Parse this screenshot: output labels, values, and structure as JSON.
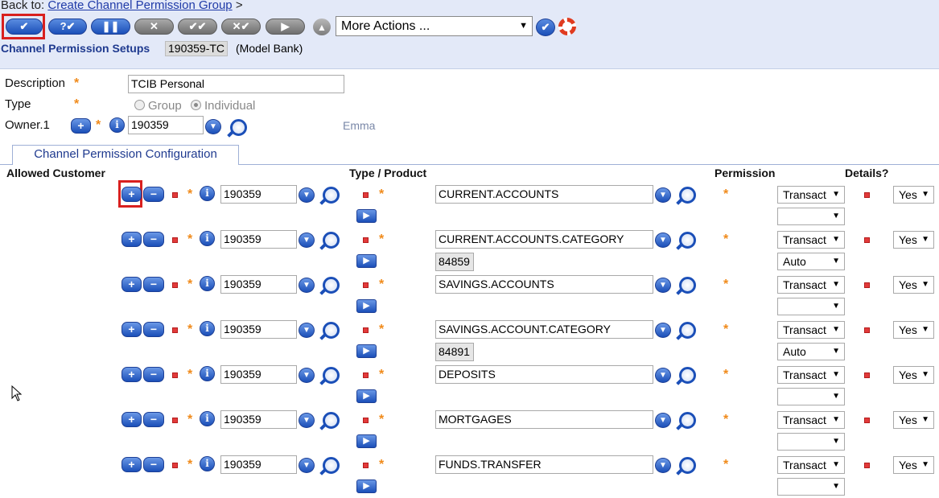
{
  "header": {
    "back_prefix": "Back to:",
    "back_link": "Create Channel Permission Group",
    "back_suffix": ">",
    "more_actions": "More Actions ...",
    "setup_title": "Channel Permission Setups",
    "record_id": "190359-TC",
    "bank": "(Model Bank)"
  },
  "toolbar": [
    "commit",
    "validate",
    "hold",
    "delete",
    "authorise",
    "reverse",
    "next"
  ],
  "form": {
    "description_label": "Description",
    "description_value": "TCIB Personal",
    "type_label": "Type",
    "type_group": "Group",
    "type_individual": "Individual",
    "owner_label": "Owner.1",
    "owner_value": "190359",
    "owner_name": "Emma"
  },
  "tab": {
    "label": "Channel Permission Configuration"
  },
  "columns": {
    "allowed_customer": "Allowed Customer",
    "type_product": "Type / Product",
    "permission": "Permission",
    "details": "Details?"
  },
  "rows": [
    {
      "customer": "190359",
      "product": "CURRENT.ACCOUNTS",
      "category": "",
      "permission": "Transact",
      "perm2": "",
      "details": "Yes"
    },
    {
      "customer": "190359",
      "product": "CURRENT.ACCOUNTS.CATEGORY",
      "category": "84859",
      "permission": "Transact",
      "perm2": "Auto",
      "details": "Yes"
    },
    {
      "customer": "190359",
      "product": "SAVINGS.ACCOUNTS",
      "category": "",
      "permission": "Transact",
      "perm2": "",
      "details": "Yes"
    },
    {
      "customer": "190359",
      "product": "SAVINGS.ACCOUNT.CATEGORY",
      "category": "84891",
      "permission": "Transact",
      "perm2": "Auto",
      "details": "Yes"
    },
    {
      "customer": "190359",
      "product": "DEPOSITS",
      "category": "",
      "permission": "Transact",
      "perm2": "",
      "details": "Yes"
    },
    {
      "customer": "190359",
      "product": "MORTGAGES",
      "category": "",
      "permission": "Transact",
      "perm2": "",
      "details": "Yes"
    },
    {
      "customer": "190359",
      "product": "FUNDS.TRANSFER",
      "category": "",
      "permission": "Transact",
      "perm2": "",
      "details": "Yes"
    }
  ]
}
